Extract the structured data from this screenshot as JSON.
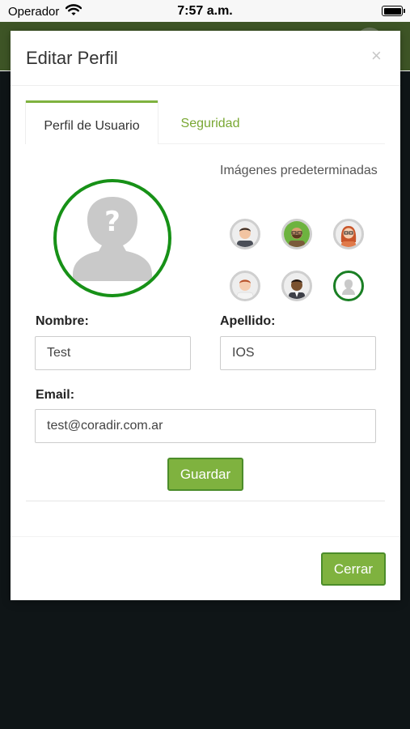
{
  "status_bar": {
    "carrier": "Operador",
    "time": "7:57 a.m."
  },
  "modal": {
    "title": "Editar Perfil",
    "close_glyph": "×",
    "tabs": [
      {
        "label": "Perfil de Usuario",
        "active": true
      },
      {
        "label": "Seguridad",
        "active": false
      }
    ],
    "defaults_label": "Imágenes predeterminadas",
    "default_images": [
      {
        "icon": "man-dark-hair-avatar"
      },
      {
        "icon": "man-beard-glasses-avatar"
      },
      {
        "icon": "woman-red-hair-avatar"
      },
      {
        "icon": "man-red-hair-avatar"
      },
      {
        "icon": "man-dark-skin-avatar"
      },
      {
        "icon": "silhouette-avatar",
        "selected": true
      }
    ],
    "form": {
      "first_name_label": "Nombre:",
      "first_name_value": "Test",
      "last_name_label": "Apellido:",
      "last_name_value": "IOS",
      "email_label": "Email:",
      "email_value": "test@coradir.com.ar",
      "save_label": "Guardar"
    },
    "footer": {
      "close_label": "Cerrar"
    }
  },
  "colors": {
    "accent": "#7fb23f",
    "accent_border": "#4c8d2a",
    "avatar_ring": "#179117",
    "header_bg": "#3e5526"
  }
}
